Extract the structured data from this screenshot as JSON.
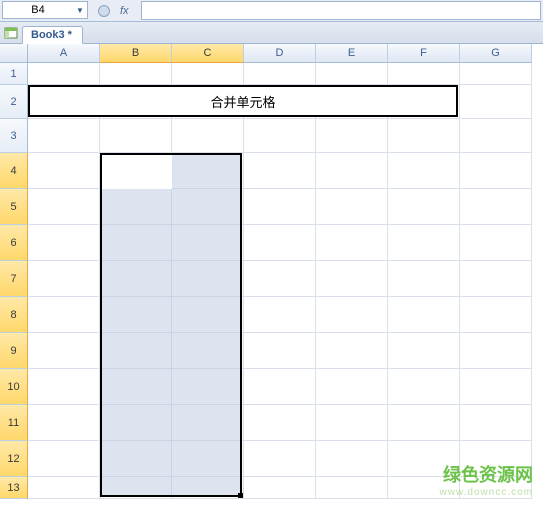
{
  "nameBox": {
    "value": "B4"
  },
  "formula": {
    "fxLabel": "fx",
    "value": ""
  },
  "workbookTab": {
    "label": "Book3 *"
  },
  "columns": [
    "A",
    "B",
    "C",
    "D",
    "E",
    "F",
    "G"
  ],
  "selectedColumns": [
    "B",
    "C"
  ],
  "rows": {
    "heights": [
      22,
      34,
      34,
      36,
      36,
      36,
      36,
      36,
      36,
      36,
      36,
      36,
      22
    ],
    "selected": [
      4,
      5,
      6,
      7,
      8,
      9,
      10,
      11,
      12,
      13
    ]
  },
  "mergedCell": {
    "text": "合并单元格",
    "row": 2,
    "colStart": "A",
    "colEnd": "F"
  },
  "selection": {
    "activeCell": "B4",
    "range": "B4:C13"
  },
  "watermark": {
    "main": "绿色资源网",
    "sub": "www.downcc.com"
  }
}
